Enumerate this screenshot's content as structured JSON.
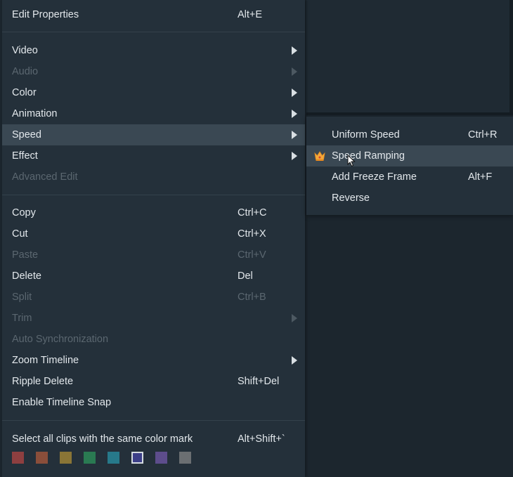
{
  "context_menu": {
    "edit_properties": {
      "label": "Edit Properties",
      "shortcut": "Alt+E"
    },
    "video": {
      "label": "Video"
    },
    "audio": {
      "label": "Audio"
    },
    "color": {
      "label": "Color"
    },
    "animation": {
      "label": "Animation"
    },
    "speed": {
      "label": "Speed"
    },
    "effect": {
      "label": "Effect"
    },
    "advanced_edit": {
      "label": "Advanced Edit"
    },
    "copy": {
      "label": "Copy",
      "shortcut": "Ctrl+C"
    },
    "cut": {
      "label": "Cut",
      "shortcut": "Ctrl+X"
    },
    "paste": {
      "label": "Paste",
      "shortcut": "Ctrl+V"
    },
    "delete": {
      "label": "Delete",
      "shortcut": "Del"
    },
    "split": {
      "label": "Split",
      "shortcut": "Ctrl+B"
    },
    "trim": {
      "label": "Trim"
    },
    "auto_sync": {
      "label": "Auto Synchronization"
    },
    "zoom_timeline": {
      "label": "Zoom Timeline"
    },
    "ripple_delete": {
      "label": "Ripple Delete",
      "shortcut": "Shift+Del"
    },
    "timeline_snap": {
      "label": "Enable Timeline Snap"
    },
    "select_same_color": {
      "label": "Select all clips with the same color mark",
      "shortcut": "Alt+Shift+`"
    },
    "color_marks": [
      "#8e3f40",
      "#8a4e3a",
      "#8a7536",
      "#2a7a52",
      "#27798a",
      "#3c3f88",
      "#5d4d8c",
      "#6b6f72"
    ],
    "selected_color_index": 5
  },
  "speed_submenu": {
    "uniform_speed": {
      "label": "Uniform Speed",
      "shortcut": "Ctrl+R"
    },
    "speed_ramping": {
      "label": "Speed Ramping",
      "icon": "crown-icon"
    },
    "freeze_frame": {
      "label": "Add Freeze Frame",
      "shortcut": "Alt+F"
    },
    "reverse": {
      "label": "Reverse"
    }
  }
}
